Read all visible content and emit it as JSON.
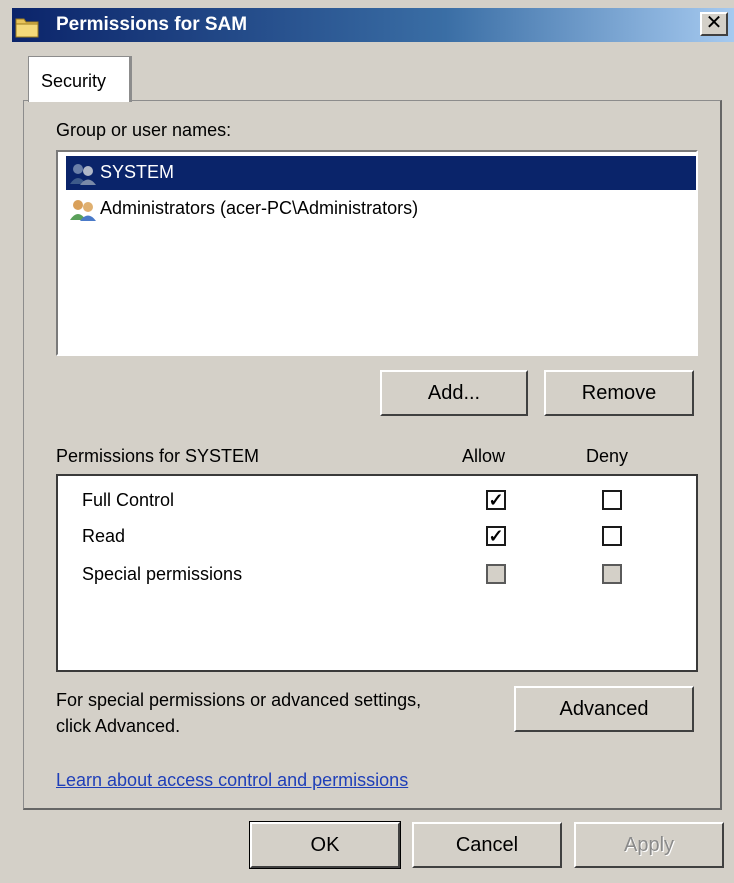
{
  "window": {
    "title": "Permissions for SAM",
    "close_glyph": "✕"
  },
  "tab": {
    "label": "Security"
  },
  "group_label": "Group or user names:",
  "users": [
    {
      "name": "SYSTEM",
      "icon": "users-icon",
      "selected": true
    },
    {
      "name": "Administrators (acer-PC\\Administrators)",
      "icon": "users-icon",
      "selected": false
    }
  ],
  "buttons": {
    "add": "Add...",
    "remove": "Remove",
    "advanced": "Advanced",
    "ok": "OK",
    "cancel": "Cancel",
    "apply": "Apply"
  },
  "permissions": {
    "header": "Permissions for SYSTEM",
    "allow_label": "Allow",
    "deny_label": "Deny",
    "rows": [
      {
        "name": "Full Control",
        "allow": true,
        "deny": false
      },
      {
        "name": "Read",
        "allow": true,
        "deny": false
      },
      {
        "name": "Special permissions",
        "allow": false,
        "deny": false,
        "disabled": true
      }
    ]
  },
  "advanced_text_line1": "For special permissions or advanced settings,",
  "advanced_text_line2": "click Advanced.",
  "link": "Learn about access control and permissions",
  "colors": {
    "selection": "#0a246a",
    "titlebar_start": "#0b246a",
    "link": "#1f3fb8"
  }
}
